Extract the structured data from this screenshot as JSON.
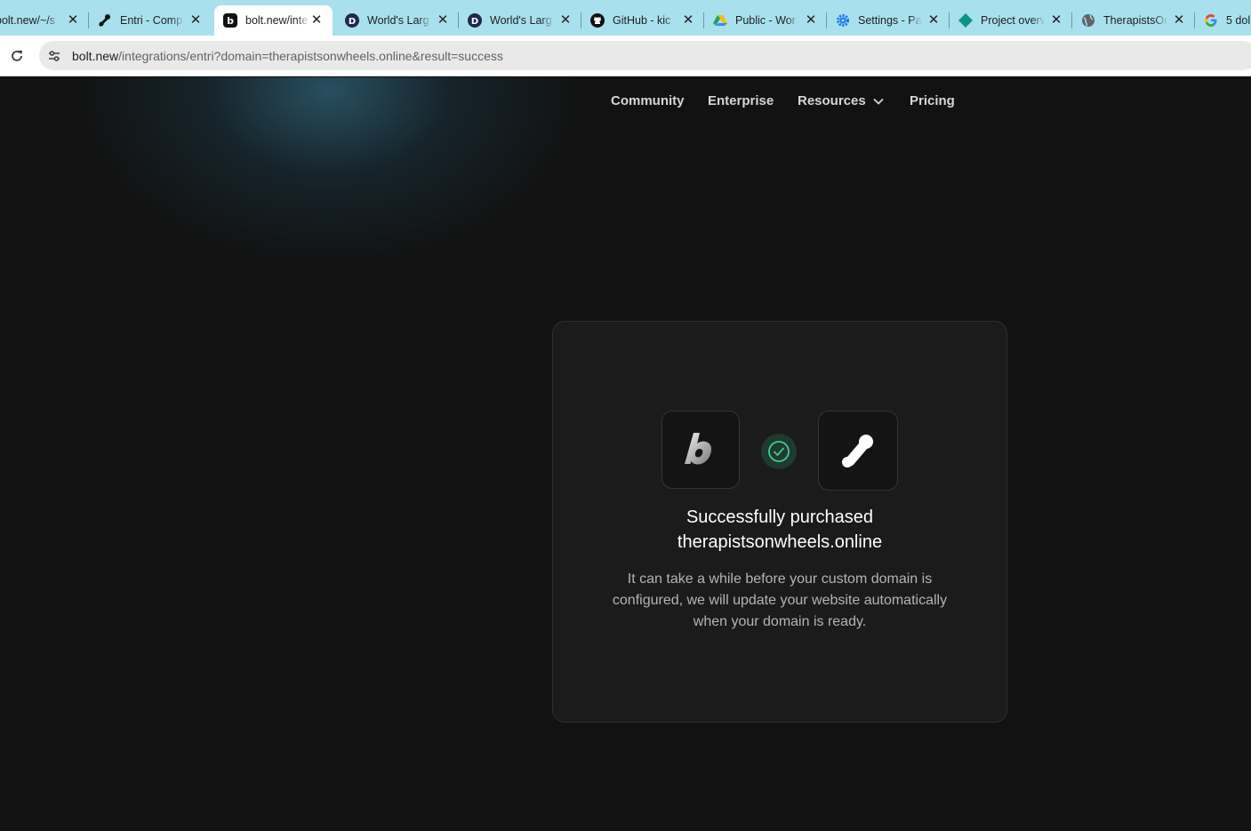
{
  "browser": {
    "tabs": [
      {
        "title": "bolt.new/~/s",
        "favicon": "bolt-icon"
      },
      {
        "title": "Entri - Comp",
        "favicon": "entri-icon"
      },
      {
        "title": "bolt.new/inte",
        "favicon": "bolt-icon",
        "active": true
      },
      {
        "title": "World's Larg",
        "favicon": "d-icon"
      },
      {
        "title": "World's Larg",
        "favicon": "d-icon"
      },
      {
        "title": "GitHub - kic",
        "favicon": "github-icon"
      },
      {
        "title": "Public - Wor",
        "favicon": "drive-icon"
      },
      {
        "title": "Settings - Pa",
        "favicon": "gear-icon"
      },
      {
        "title": "Project overv",
        "favicon": "diamond-icon"
      },
      {
        "title": "TherapistsOr",
        "favicon": "globe-icon"
      },
      {
        "title": "5 dol",
        "favicon": "google-icon"
      }
    ],
    "address": {
      "host": "bolt.new",
      "path": "/integrations/entri?domain=therapistsonwheels.online&result=success"
    }
  },
  "nav": {
    "community": "Community",
    "enterprise": "Enterprise",
    "resources": "Resources",
    "pricing": "Pricing"
  },
  "card": {
    "title_line1": "Successfully purchased",
    "title_line2": "therapistsonwheels.online",
    "description": "It can take a while before your custom domain is configured, we will update your website automatically when your domain is ready."
  },
  "colors": {
    "tabstrip": "#a8e0ed",
    "page_bg": "#121212",
    "card_bg": "#1b1b1c",
    "success": "#3ecf8e"
  }
}
